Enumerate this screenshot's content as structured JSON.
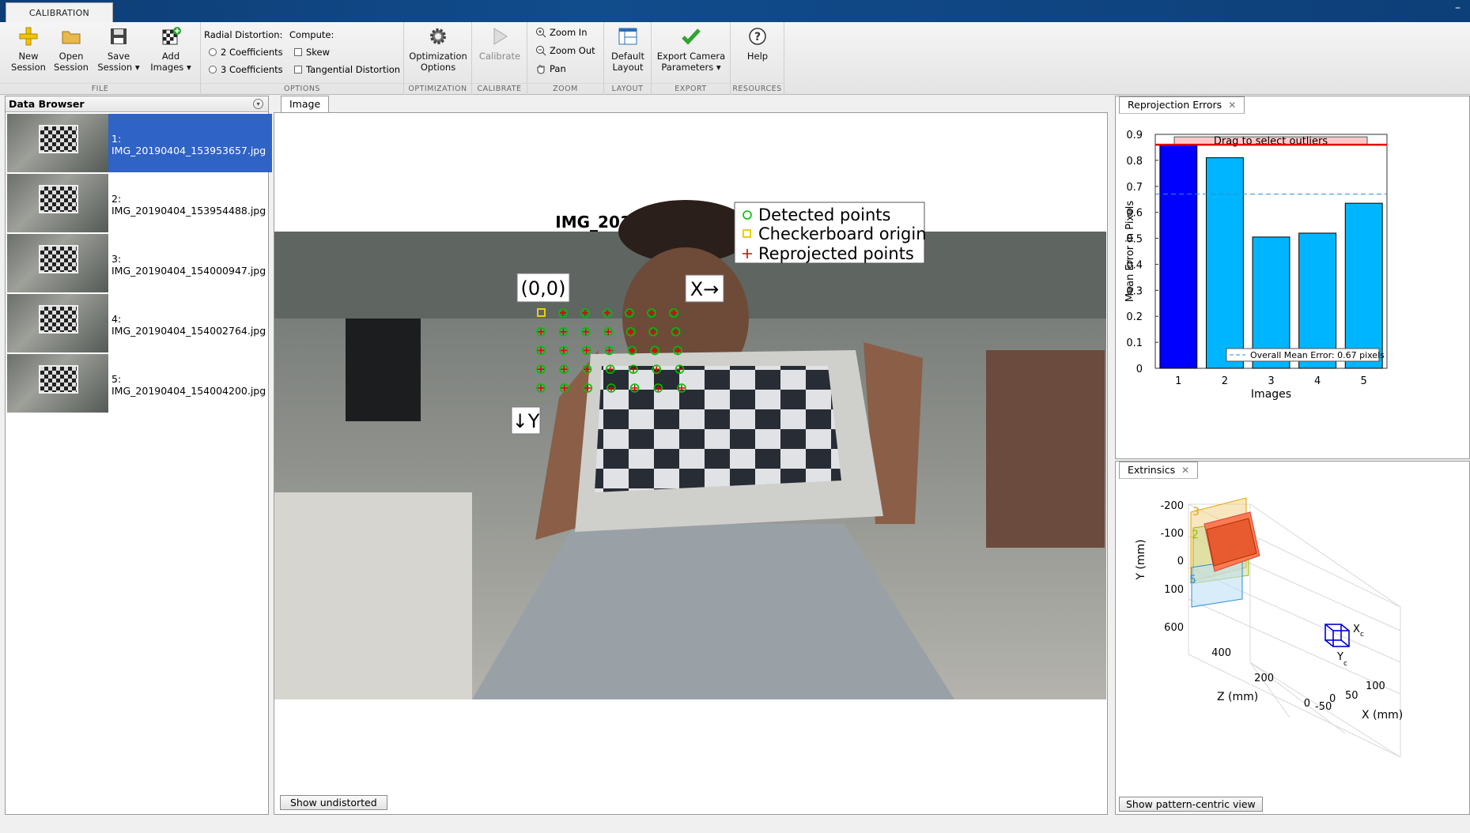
{
  "window": {
    "tab_label": "CALIBRATION",
    "min_glyph": "–"
  },
  "toolstrip": {
    "file": {
      "label": "FILE",
      "new_session": [
        "New",
        "Session"
      ],
      "open_session": [
        "Open",
        "Session"
      ],
      "save_session": [
        "Save",
        "Session ▾"
      ],
      "add_images": [
        "Add",
        "Images ▾"
      ]
    },
    "options": {
      "label": "OPTIONS",
      "radial_label": "Radial Distortion:",
      "compute_label": "Compute:",
      "radial_options": [
        "2 Coefficients",
        "3 Coefficients"
      ],
      "compute_options": [
        "Skew",
        "Tangential Distortion"
      ]
    },
    "optimization": {
      "label": "OPTIMIZATION",
      "button": [
        "Optimization",
        "Options"
      ]
    },
    "calibrate": {
      "label": "CALIBRATE",
      "button": "Calibrate"
    },
    "zoom": {
      "label": "ZOOM",
      "zoom_in": "Zoom In",
      "zoom_out": "Zoom Out",
      "pan": "Pan"
    },
    "layout": {
      "label": "LAYOUT",
      "button": [
        "Default",
        "Layout"
      ]
    },
    "export": {
      "label": "EXPORT",
      "button": [
        "Export Camera",
        "Parameters ▾"
      ]
    },
    "resources": {
      "label": "RESOURCES",
      "button": "Help"
    }
  },
  "data_browser": {
    "title": "Data Browser",
    "items": [
      {
        "index": "1:",
        "file": "IMG_20190404_153953657.jpg",
        "selected": true
      },
      {
        "index": "2:",
        "file": "IMG_20190404_153954488.jpg",
        "selected": false
      },
      {
        "index": "3:",
        "file": "IMG_20190404_154000947.jpg",
        "selected": false
      },
      {
        "index": "4:",
        "file": "IMG_20190404_154002764.jpg",
        "selected": false
      },
      {
        "index": "5:",
        "file": "IMG_20190404_154004200.jpg",
        "selected": false
      }
    ]
  },
  "image_panel": {
    "tab": "Image",
    "title": "IMG_20190404_153953657.jpg",
    "legend": [
      "Detected points",
      "Checkerboard origin",
      "Reprojected points"
    ],
    "origin_label": "(0,0)",
    "x_label": "X→",
    "y_label": "↓Y",
    "button": "Show undistorted"
  },
  "reprojection_panel": {
    "tab": "Reprojection Errors",
    "outlier_label": "Drag to select outliers",
    "legend": "Overall Mean Error: 0.67 pixels"
  },
  "extrinsics_panel": {
    "tab": "Extrinsics",
    "button": "Show pattern-centric view",
    "ylabel": "Y (mm)",
    "zlabel": "Z (mm)",
    "xlabel": "X (mm)",
    "y_ticks": [
      "-200",
      "-100",
      "0",
      "100"
    ],
    "z_ticks": [
      "600",
      "400",
      "200",
      "0"
    ],
    "x_ticks": [
      "-50",
      "0",
      "50",
      "100"
    ],
    "board_labels": [
      "3",
      "2",
      "5"
    ],
    "camera_labels": [
      "X",
      "c",
      "Y",
      "c"
    ]
  },
  "chart_data": {
    "type": "bar",
    "categories": [
      "1",
      "2",
      "3",
      "4",
      "5"
    ],
    "values": [
      0.86,
      0.81,
      0.505,
      0.52,
      0.635
    ],
    "selected_index": 0,
    "overall_mean": 0.67,
    "outlier_threshold": 0.86,
    "xlabel": "Images",
    "ylabel": "Mean Error in Pixels",
    "ylim": [
      0,
      0.9
    ],
    "yticks": [
      "0",
      "0.1",
      "0.2",
      "0.3",
      "0.4",
      "0.5",
      "0.6",
      "0.7",
      "0.8",
      "0.9"
    ],
    "colors": {
      "bar": "#00b5ff",
      "selected": "#0000ff",
      "mean_line": "#2a8fd6",
      "threshold": "#e00000"
    },
    "legend_placement": "bottom-right"
  }
}
